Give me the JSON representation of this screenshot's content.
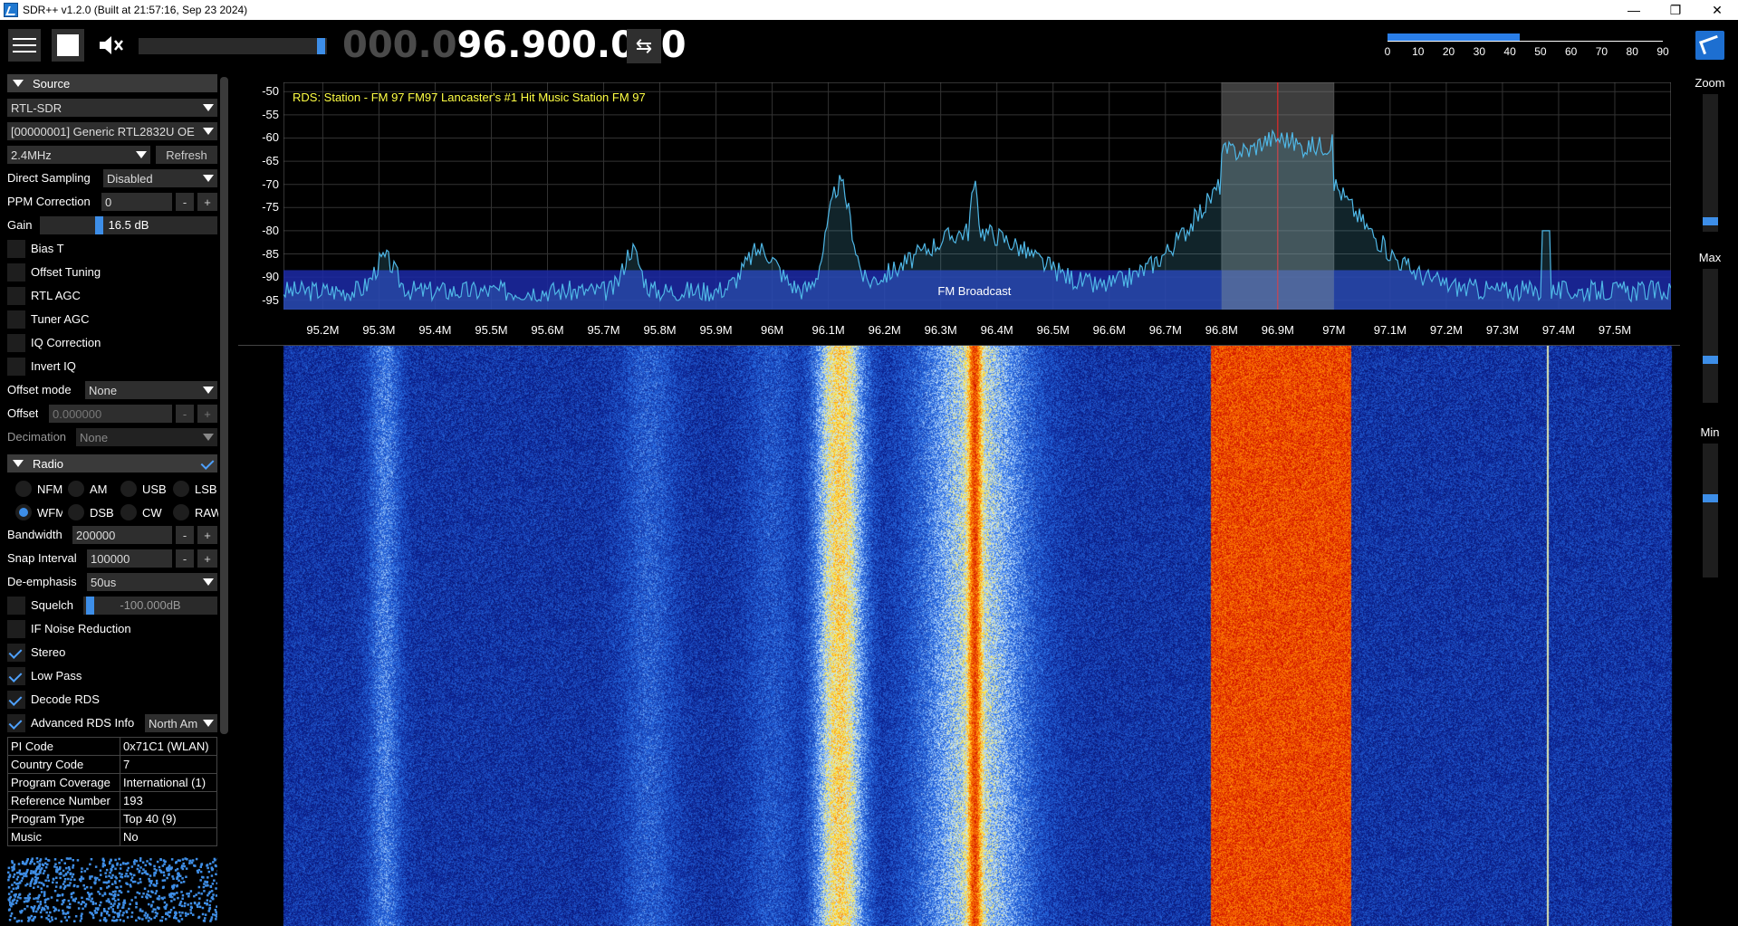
{
  "window": {
    "title": "SDR++ v1.2.0 (Built at 21:57:16, Sep 23 2024)",
    "minimize": "—",
    "maximize": "❐",
    "close": "✕"
  },
  "toolbar": {
    "menu_icon": "hamburger-menu-icon",
    "play_icon": "stop-square-icon",
    "mute_icon": "speaker-muted-icon",
    "volume": 0.95,
    "freq_dim": "000.0",
    "freq_lit": "96.900.000",
    "swap_icon": "⇆",
    "snr_fill": 0.48,
    "snr_ticks": [
      "0",
      "10",
      "20",
      "30",
      "40",
      "50",
      "60",
      "70",
      "80",
      "90"
    ],
    "corner_icon": "sdrpp-logo-icon"
  },
  "source": {
    "header": "Source",
    "device": "RTL-SDR",
    "serial": "[00000001] Generic RTL2832U OE",
    "samplerate": "2.4MHz",
    "refresh": "Refresh",
    "direct_sampling_label": "Direct Sampling",
    "direct_sampling_value": "Disabled",
    "ppm_label": "PPM Correction",
    "ppm_value": "0",
    "minus": "-",
    "plus": "+",
    "gain_label": "Gain",
    "gain_value": "16.5 dB",
    "gain_fraction": 0.33,
    "bias_t": "Bias T",
    "offset_tuning": "Offset Tuning",
    "rtl_agc": "RTL AGC",
    "tuner_agc": "Tuner AGC",
    "iq_correction": "IQ Correction",
    "invert_iq": "Invert IQ",
    "offset_mode_label": "Offset mode",
    "offset_mode_value": "None",
    "offset_label": "Offset",
    "offset_value": "0.000000",
    "decimation_label": "Decimation",
    "decimation_value": "None"
  },
  "radio": {
    "header": "Radio",
    "modes_row1": [
      "NFM",
      "AM",
      "USB",
      "LSB"
    ],
    "modes_row2": [
      "WFM",
      "DSB",
      "CW",
      "RAW"
    ],
    "selected_mode": "WFM",
    "bandwidth_label": "Bandwidth",
    "bandwidth_value": "200000",
    "snap_label": "Snap Interval",
    "snap_value": "100000",
    "deemph_label": "De-emphasis",
    "deemph_value": "50us",
    "squelch_label": "Squelch",
    "squelch_value": "-100.000dB",
    "if_nr": "IF Noise Reduction",
    "stereo": "Stereo",
    "low_pass": "Low Pass",
    "decode_rds": "Decode RDS",
    "adv_rds": "Advanced RDS Info",
    "adv_rds_region": "North Am"
  },
  "rds_info": [
    {
      "k": "PI Code",
      "v": "0x71C1 (WLAN)"
    },
    {
      "k": "Country Code",
      "v": "7"
    },
    {
      "k": "Program Coverage",
      "v": "International (1)"
    },
    {
      "k": "Reference Number",
      "v": "193"
    },
    {
      "k": "Program Type",
      "v": "Top 40 (9)"
    },
    {
      "k": "Music",
      "v": "No"
    }
  ],
  "spectrum": {
    "rds_text": "RDS: Station  - FM 97 FM97 Lancaster's #1 Hit Music Station FM 97",
    "band_label": "FM Broadcast",
    "y_ticks": [
      "-50",
      "-55",
      "-60",
      "-65",
      "-70",
      "-75",
      "-80",
      "-85",
      "-90",
      "-95"
    ],
    "x_ticks": [
      "95.2M",
      "95.3M",
      "95.4M",
      "95.5M",
      "95.6M",
      "95.7M",
      "95.8M",
      "95.9M",
      "96M",
      "96.1M",
      "96.2M",
      "96.3M",
      "96.4M",
      "96.5M",
      "96.6M",
      "96.7M",
      "96.8M",
      "96.9M",
      "97M",
      "97.1M",
      "97.2M",
      "97.3M",
      "97.4M",
      "97.5M"
    ],
    "center_mhz": 96.9,
    "vfo_bandwidth_mhz": 0.2,
    "accent": "#3d8ee8"
  },
  "right": {
    "zoom": "Zoom",
    "max": "Max",
    "min": "Min"
  }
}
